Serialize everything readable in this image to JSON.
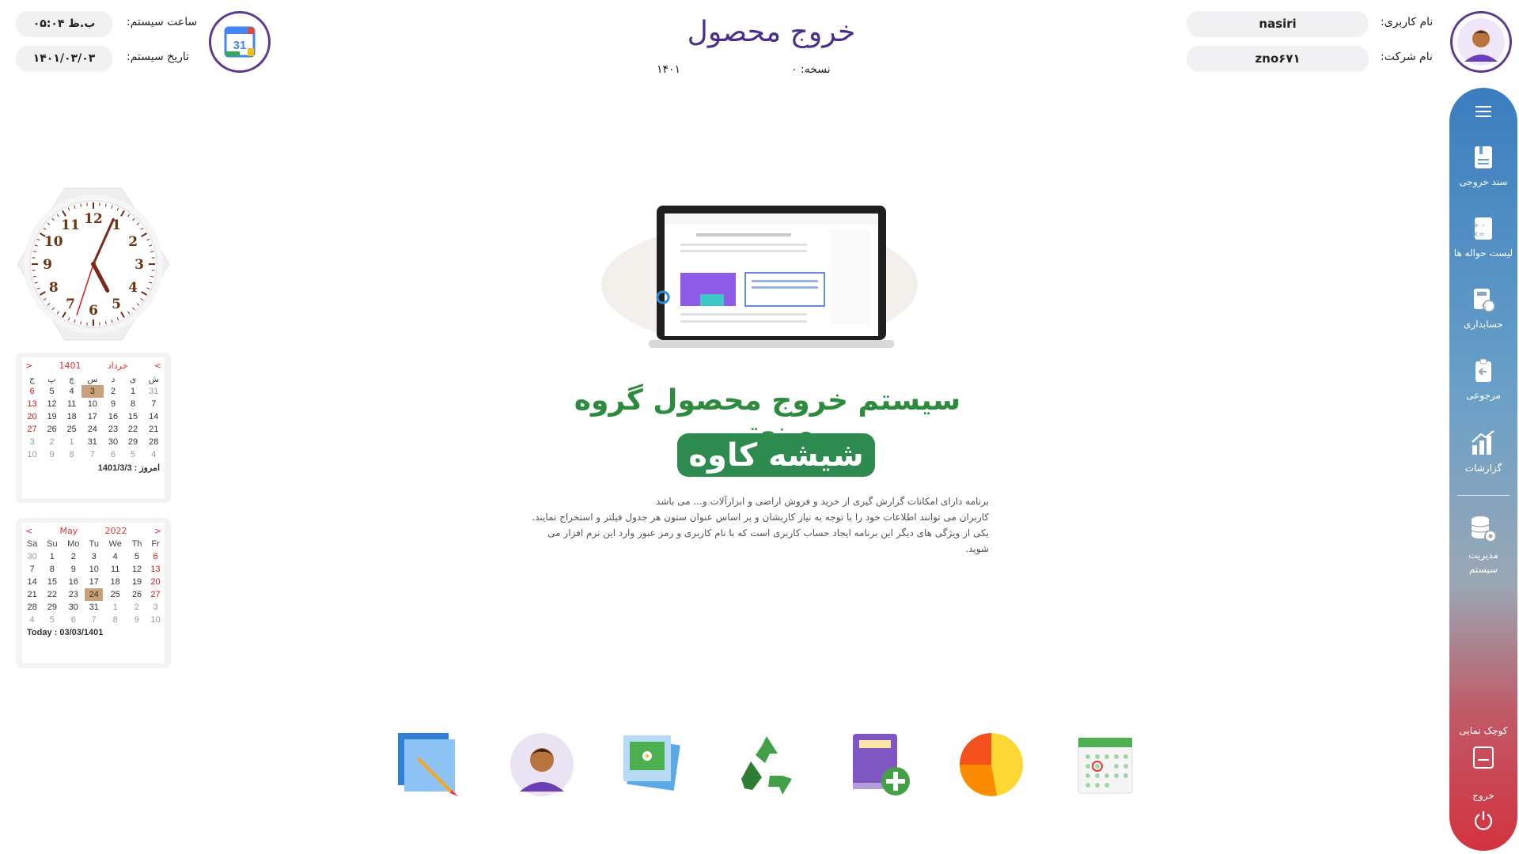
{
  "header": {
    "user_label": "نام کاربری:",
    "user_value": "nasiri",
    "company_label": "نام شرکت:",
    "company_value": "zno۶۷۱",
    "title": "خروج محصول",
    "version_label": "نسخه: ۰",
    "version_year": "۱۴۰۱",
    "time_label": "ساعت سیستم:",
    "time_value": "۰۵:۰۴ ب.ظ",
    "date_label": "تاریخ سیستم:",
    "date_value": "۱۴۰۱/۰۳/۰۳",
    "calendar_app_number": "31"
  },
  "sidebar": {
    "items": [
      {
        "label": "سند خروجی",
        "icon": "document-icon"
      },
      {
        "label": "لیست حواله ها",
        "icon": "calculator-icon"
      },
      {
        "label": "حسابداری",
        "icon": "accounting-icon"
      },
      {
        "label": "مرجوعی",
        "icon": "return-icon"
      },
      {
        "label": "گزارشات",
        "icon": "chart-icon"
      },
      {
        "label": "مدیریت سیستم",
        "icon": "database-gear-icon"
      }
    ],
    "compact_label": "کوچک نمایی",
    "exit_label": "خروج"
  },
  "clock": {
    "numbers": [
      "12",
      "1",
      "2",
      "3",
      "4",
      "5",
      "6",
      "7",
      "8",
      "9",
      "10",
      "11"
    ],
    "hour": 5,
    "minute": 4,
    "second": 33
  },
  "persian_calendar": {
    "prev": "<",
    "next": ">",
    "year": "1401",
    "month": "خرداد",
    "weekdays": [
      "ش",
      "ی",
      "د",
      "س",
      "چ",
      "پ",
      "ج"
    ],
    "rows": [
      [
        "31",
        "1",
        "2",
        "3",
        "4",
        "5",
        "6"
      ],
      [
        "7",
        "8",
        "9",
        "10",
        "11",
        "12",
        "13"
      ],
      [
        "14",
        "15",
        "16",
        "17",
        "18",
        "19",
        "20"
      ],
      [
        "21",
        "22",
        "23",
        "24",
        "25",
        "26",
        "27"
      ],
      [
        "28",
        "29",
        "30",
        "31",
        "1",
        "2",
        "3"
      ],
      [
        "4",
        "5",
        "6",
        "7",
        "8",
        "9",
        "10"
      ]
    ],
    "today_text": "امروز : 1401/3/3"
  },
  "gregorian_calendar": {
    "prev": "<",
    "next": ">",
    "month": "May",
    "year": "2022",
    "weekdays": [
      "Sa",
      "Su",
      "Mo",
      "Tu",
      "We",
      "Th",
      "Fr"
    ],
    "rows": [
      [
        "30",
        "1",
        "2",
        "3",
        "4",
        "5",
        "6"
      ],
      [
        "7",
        "8",
        "9",
        "10",
        "11",
        "12",
        "13"
      ],
      [
        "14",
        "15",
        "16",
        "17",
        "18",
        "19",
        "20"
      ],
      [
        "21",
        "22",
        "23",
        "24",
        "25",
        "26",
        "27"
      ],
      [
        "28",
        "29",
        "30",
        "31",
        "1",
        "2",
        "3"
      ],
      [
        "4",
        "5",
        "6",
        "7",
        "8",
        "9",
        "10"
      ]
    ],
    "today_text": "Today : 03/03/1401"
  },
  "hero": {
    "title": "سیستم خروج محصول گروه صنعتی",
    "brand": "شیشه کاوه",
    "desc_lines": [
      "برنامه دارای امکانات گزارش گیری از خرید و فروش اراضی و ابزارآلات و... می باشد",
      "کاربران می توانند اطلاعات خود را با توجه به نیاز کاربشان و بر اساس عنوان ستون هر جدول فیلتر و استخراج نمایند.",
      "یکی از ویژگی های دیگر این برنامه ایجاد حساب کاربری است که با نام کاربری و رمز عبور وارد این نرم افزار می شوید."
    ]
  },
  "colors": {
    "accent_purple": "#4a2f8a",
    "hero_green": "#2e8b3e",
    "brand_green": "#2e8b4f",
    "sidebar_top": "#3a7dbf",
    "sidebar_bottom": "#d3323f"
  }
}
